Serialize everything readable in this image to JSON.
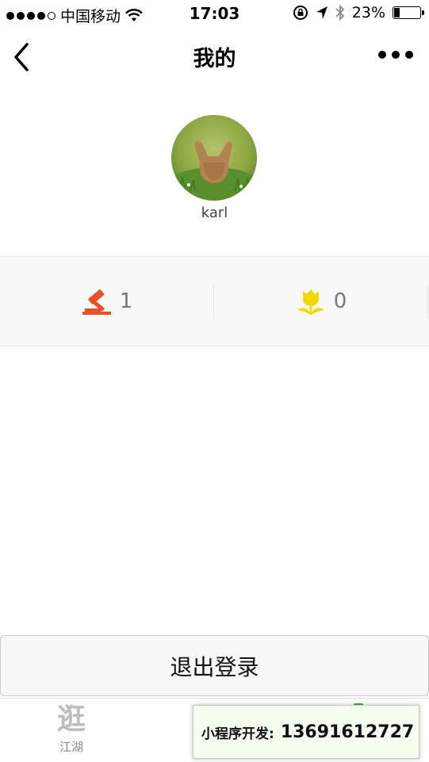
{
  "status_bar": {
    "carrier": "中国移动",
    "time": "17:03",
    "battery": "23%",
    "battery_level": 0.23,
    "icons": [
      "signal-dots",
      "wifi-icon",
      "rotation-lock-icon",
      "location-arrow-icon",
      "bluetooth-icon",
      "battery-icon"
    ]
  },
  "nav": {
    "title": "我的",
    "back_icon": "chevron-left-icon",
    "more_icon": "more-dots-icon"
  },
  "profile": {
    "username": "karl",
    "avatar": "avatar-photo-animal-in-grass"
  },
  "stats": [
    {
      "icon": "gavel-icon",
      "value": "1",
      "color": "#e8502a"
    },
    {
      "icon": "tulip-flower-icon",
      "value": "0",
      "color": "#f5d800"
    }
  ],
  "logout": {
    "label": "退出登录"
  },
  "tabbar": {
    "tab1": {
      "icon_glyph": "逛",
      "label": "江湖"
    }
  },
  "promo": {
    "label": "小程序开发:",
    "phone": "13691612727"
  }
}
